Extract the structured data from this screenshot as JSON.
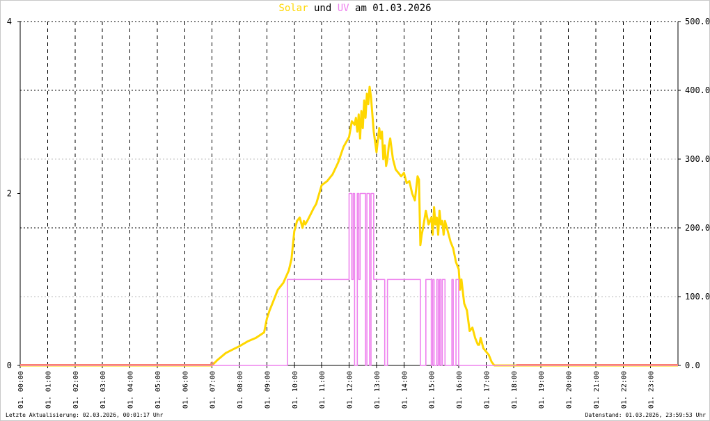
{
  "title": {
    "solar": "Solar",
    "und": "und",
    "uv": "UV",
    "rest": "am 01.03.2026"
  },
  "colors": {
    "solar": "#ffd700",
    "uv": "#ee82ee",
    "baseline": "#fa8072",
    "title_text": "#000000"
  },
  "footer": {
    "left": "Letzte Aktualisierung: 02.03.2026, 00:01:17 Uhr",
    "right": "Datenstand: 01.03.2026, 23:59:53 Uhr"
  },
  "chart_data": {
    "type": "line",
    "x_range_hours": [
      0,
      24
    ],
    "x_ticks": [
      "01. 00:00",
      "01. 01:00",
      "01. 02:00",
      "01. 03:00",
      "01. 04:00",
      "01. 05:00",
      "01. 06:00",
      "01. 07:00",
      "01. 08:00",
      "01. 09:00",
      "01. 10:00",
      "01. 11:00",
      "01. 12:00",
      "01. 13:00",
      "01. 14:00",
      "01. 15:00",
      "01. 16:00",
      "01. 17:00",
      "01. 18:00",
      "01. 19:00",
      "01. 20:00",
      "01. 21:00",
      "01. 22:00",
      "01. 23:00"
    ],
    "y_left": {
      "range": [
        0,
        4
      ],
      "ticks": [
        "0",
        "2",
        "4"
      ]
    },
    "y_right": {
      "range": [
        0,
        500
      ],
      "ticks": [
        "0.0",
        "100.0",
        "200.0",
        "300.0",
        "400.0",
        "500.0"
      ]
    },
    "grid": true,
    "series": [
      {
        "name": "Solar",
        "axis": "right",
        "x": [
          0,
          7.0,
          7.2,
          7.5,
          7.8,
          8.0,
          8.3,
          8.6,
          8.9,
          9.0,
          9.1,
          9.2,
          9.4,
          9.6,
          9.8,
          9.9,
          10.0,
          10.1,
          10.2,
          10.3,
          10.35,
          10.4,
          10.5,
          10.6,
          10.7,
          10.8,
          11.0,
          11.2,
          11.4,
          11.6,
          11.8,
          12.0,
          12.1,
          12.2,
          12.25,
          12.3,
          12.35,
          12.4,
          12.45,
          12.5,
          12.55,
          12.6,
          12.65,
          12.7,
          12.75,
          12.8,
          12.9,
          13.0,
          13.1,
          13.15,
          13.2,
          13.25,
          13.3,
          13.35,
          13.4,
          13.45,
          13.5,
          13.6,
          13.7,
          13.8,
          13.9,
          14.0,
          14.1,
          14.2,
          14.3,
          14.4,
          14.5,
          14.55,
          14.6,
          14.65,
          14.7,
          14.8,
          14.9,
          15.0,
          15.05,
          15.1,
          15.15,
          15.2,
          15.25,
          15.3,
          15.35,
          15.4,
          15.45,
          15.5,
          15.6,
          15.7,
          15.8,
          15.9,
          16.0,
          16.05,
          16.1,
          16.2,
          16.3,
          16.4,
          16.5,
          16.6,
          16.65,
          16.7,
          16.75,
          16.8,
          16.9,
          17.0,
          17.1,
          17.2,
          17.3,
          17.5,
          17.7,
          17.9,
          18.0,
          18.1,
          24
        ],
        "y": [
          0,
          0,
          8,
          18,
          24,
          28,
          35,
          40,
          48,
          68,
          80,
          90,
          110,
          120,
          138,
          155,
          195,
          210,
          215,
          200,
          210,
          205,
          212,
          220,
          228,
          235,
          262,
          268,
          278,
          295,
          318,
          332,
          355,
          350,
          360,
          340,
          365,
          330,
          370,
          345,
          385,
          360,
          395,
          380,
          405,
          390,
          340,
          310,
          345,
          330,
          340,
          300,
          320,
          290,
          300,
          320,
          330,
          300,
          285,
          280,
          275,
          280,
          265,
          268,
          250,
          240,
          275,
          270,
          175,
          190,
          200,
          225,
          205,
          215,
          190,
          230,
          205,
          215,
          190,
          225,
          205,
          210,
          190,
          210,
          195,
          180,
          170,
          150,
          140,
          110,
          125,
          90,
          80,
          50,
          55,
          40,
          35,
          30,
          30,
          40,
          25,
          20,
          15,
          5,
          0,
          0,
          0,
          0,
          0,
          0,
          0
        ]
      },
      {
        "name": "UV",
        "axis": "left",
        "x": [
          0,
          9.75,
          9.75,
          12.0,
          12.0,
          12.1,
          12.1,
          12.15,
          12.15,
          12.2,
          12.2,
          12.3,
          12.3,
          12.35,
          12.35,
          12.4,
          12.4,
          12.6,
          12.6,
          12.65,
          12.65,
          12.75,
          12.75,
          12.8,
          12.8,
          12.9,
          12.9,
          13.3,
          13.3,
          13.4,
          13.4,
          13.45,
          13.45,
          14.6,
          14.6,
          14.8,
          14.8,
          15.0,
          15.0,
          15.05,
          15.05,
          15.1,
          15.1,
          15.2,
          15.2,
          15.25,
          15.25,
          15.3,
          15.3,
          15.35,
          15.35,
          15.4,
          15.4,
          15.5,
          15.5,
          15.75,
          15.75,
          15.8,
          15.8,
          15.9,
          15.9,
          16.0,
          16.0,
          24
        ],
        "y": [
          0,
          0,
          1,
          1,
          2,
          2,
          1,
          1,
          2,
          2,
          0,
          0,
          2,
          2,
          1,
          1,
          2,
          2,
          0,
          0,
          2,
          2,
          0,
          0,
          2,
          2,
          1,
          1,
          0,
          0,
          1,
          1,
          1,
          1,
          0,
          0,
          1,
          1,
          0,
          0,
          1,
          1,
          0,
          0,
          1,
          1,
          0,
          0,
          1,
          1,
          0,
          0,
          1,
          1,
          0,
          0,
          1,
          1,
          0,
          0,
          1,
          1,
          0,
          0
        ]
      }
    ]
  }
}
